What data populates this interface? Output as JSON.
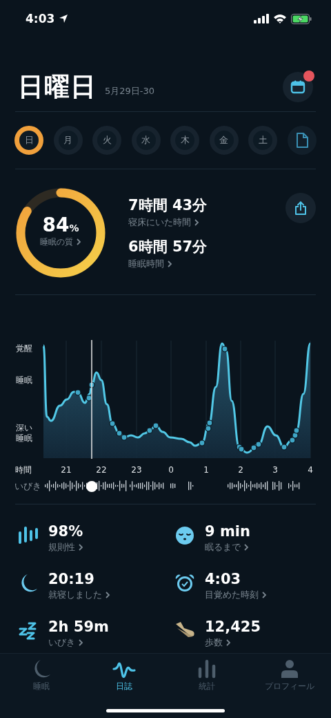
{
  "status_bar": {
    "time": "4:03"
  },
  "header": {
    "title": "日曜日",
    "date_range": "5月29日-30",
    "calendar_badge": true
  },
  "days": [
    {
      "label": "日",
      "selected": true
    },
    {
      "label": "月",
      "selected": false
    },
    {
      "label": "火",
      "selected": false
    },
    {
      "label": "水",
      "selected": false
    },
    {
      "label": "木",
      "selected": false
    },
    {
      "label": "金",
      "selected": false
    },
    {
      "label": "土",
      "selected": false
    }
  ],
  "summary": {
    "quality": {
      "value": "84",
      "unit": "%",
      "label": "睡眠の質"
    },
    "metrics": [
      {
        "value": "7時間 43分",
        "label": "寝床にいた時間"
      },
      {
        "value": "6時間 57分",
        "label": "睡眠時間"
      }
    ]
  },
  "chart": {
    "y_labels": [
      "覚醒",
      "睡眠",
      "深い睡眠"
    ],
    "x_title": "時間",
    "x_labels": [
      "21",
      "22",
      "23",
      "0",
      "1",
      "2",
      "3",
      "4"
    ],
    "snore_label": "いびき"
  },
  "stats": [
    {
      "kind": "regularity",
      "value": "98%",
      "label": "規則性"
    },
    {
      "kind": "latency",
      "value": "9 min",
      "label": "眠るまで"
    },
    {
      "kind": "bedtime",
      "value": "20:19",
      "label": "就寝しました"
    },
    {
      "kind": "wake",
      "value": "4:03",
      "label": "目覚めた時刻"
    },
    {
      "kind": "snore",
      "value": "2h 59m",
      "label": "いびき"
    },
    {
      "kind": "steps",
      "value": "12,425",
      "label": "歩数"
    }
  ],
  "tabs": [
    {
      "kind": "sleep",
      "label": "睡眠",
      "selected": false
    },
    {
      "kind": "journal",
      "label": "日誌",
      "selected": true
    },
    {
      "kind": "stats",
      "label": "統計",
      "selected": false
    },
    {
      "kind": "profile",
      "label": "プロフィール",
      "selected": false
    }
  ]
}
